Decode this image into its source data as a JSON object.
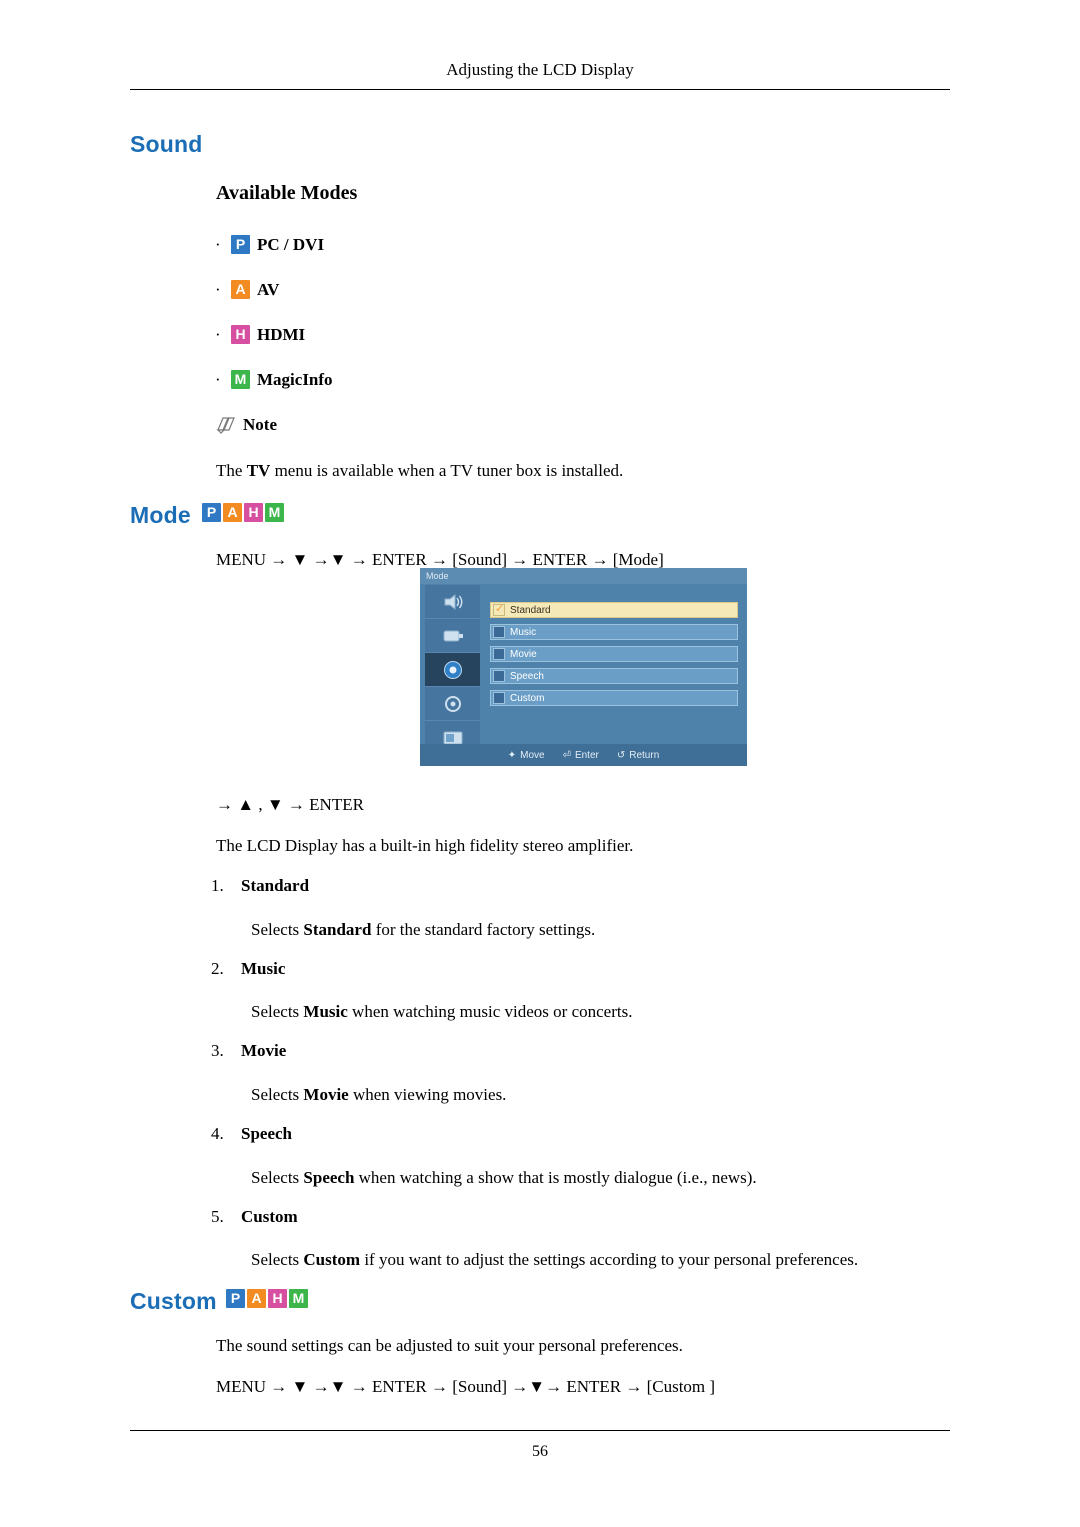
{
  "header": {
    "running_title": "Adjusting the LCD Display"
  },
  "footer": {
    "page_number": "56"
  },
  "sections": {
    "sound_title": "Sound",
    "available_modes_title": "Available Modes",
    "mode_title": "Mode",
    "custom_title": "Custom"
  },
  "available_modes": [
    {
      "badge": "P",
      "badge_color": "#2f78c4",
      "label": "PC / DVI"
    },
    {
      "badge": "A",
      "badge_color": "#f28c22",
      "label": "AV"
    },
    {
      "badge": "H",
      "badge_color": "#d74fa0",
      "label": "HDMI"
    },
    {
      "badge": "M",
      "badge_color": "#3cb54a",
      "label": "MagicInfo"
    }
  ],
  "note": {
    "label": "Note",
    "text_prefix": "The ",
    "text_bold": "TV",
    "text_suffix": " menu is available when a TV tuner box is installed."
  },
  "mode": {
    "badges": [
      "P",
      "A",
      "H",
      "M"
    ],
    "menu_path": "MENU → ▼ →▼ → ENTER → [Sound] → ENTER → [Mode]",
    "navigation": "→ ▲ , ▼ → ENTER",
    "description": "The LCD Display has a built-in high fidelity stereo amplifier.",
    "items": [
      {
        "num": "1.",
        "name": "Standard",
        "desc_prefix": "Selects ",
        "desc_bold": "Standard",
        "desc_suffix": " for the standard factory settings."
      },
      {
        "num": "2.",
        "name": "Music",
        "desc_prefix": "Selects ",
        "desc_bold": "Music",
        "desc_suffix": " when watching music videos or concerts."
      },
      {
        "num": "3.",
        "name": "Movie",
        "desc_prefix": "Selects ",
        "desc_bold": "Movie",
        "desc_suffix": " when viewing movies."
      },
      {
        "num": "4.",
        "name": "Speech",
        "desc_prefix": "Selects ",
        "desc_bold": "Speech",
        "desc_suffix": " when watching a show that is mostly dialogue (i.e., news)."
      },
      {
        "num": "5.",
        "name": "Custom",
        "desc_prefix": "Selects ",
        "desc_bold": "Custom",
        "desc_suffix": " if you want to adjust the settings according to your personal preferences."
      }
    ]
  },
  "osd": {
    "title": "Mode",
    "options": [
      {
        "label": "Standard",
        "checked": true,
        "highlight": true
      },
      {
        "label": "Music",
        "checked": false,
        "highlight": false
      },
      {
        "label": "Movie",
        "checked": false,
        "highlight": false
      },
      {
        "label": "Speech",
        "checked": false,
        "highlight": false
      },
      {
        "label": "Custom",
        "checked": false,
        "highlight": false
      }
    ],
    "footer": [
      {
        "icon": "move-icon",
        "label": "Move"
      },
      {
        "icon": "enter-icon",
        "label": "Enter"
      },
      {
        "icon": "return-icon",
        "label": "Return"
      }
    ],
    "selected_icon_index": 2
  },
  "custom": {
    "badges": [
      "P",
      "A",
      "H",
      "M"
    ],
    "description": "The sound settings can be adjusted to suit your personal preferences.",
    "menu_path": "MENU → ▼ →▼ → ENTER → [Sound] →▼→ ENTER → [Custom ]"
  }
}
